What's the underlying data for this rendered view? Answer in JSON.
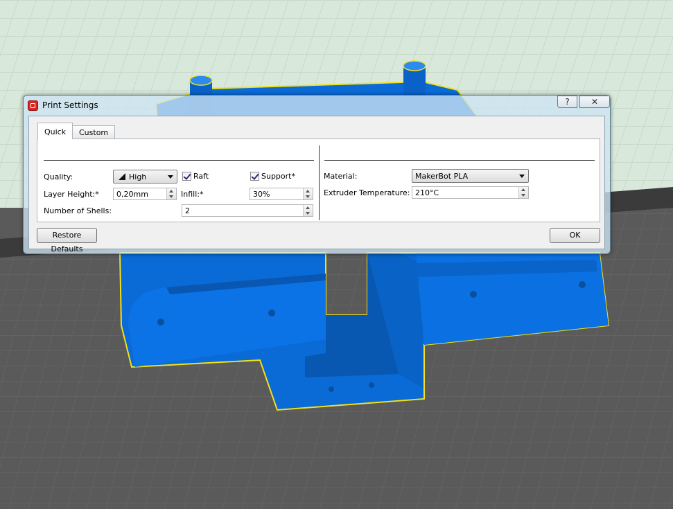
{
  "window": {
    "title": "Print Settings",
    "help_glyph": "?",
    "close_glyph": "✕"
  },
  "tabs": [
    {
      "label": "Quick",
      "active": true
    },
    {
      "label": "Custom",
      "active": false
    }
  ],
  "quick": {
    "quality_label": "Quality:",
    "quality_value": "High",
    "raft_label": "Raft",
    "raft_checked": true,
    "support_label": "Support*",
    "support_checked": true,
    "layer_height_label": "Layer Height:*",
    "layer_height_value": "0,20mm",
    "infill_label": "Infill:*",
    "infill_value": "30%",
    "shells_label": "Number of Shells:",
    "shells_value": "2",
    "material_label": "Material:",
    "material_value": "MakerBot PLA",
    "extruder_temp_label": "Extruder Temperature: *",
    "extruder_temp_value": "210°C"
  },
  "buttons": {
    "restore_defaults": "Restore Defaults",
    "ok": "OK"
  },
  "colors": {
    "model_blue": "#0a6ad6",
    "outline_yellow": "#f2e11b",
    "platform_grey": "#5a5a5a",
    "backdrop_mint": "#d8e8da"
  }
}
